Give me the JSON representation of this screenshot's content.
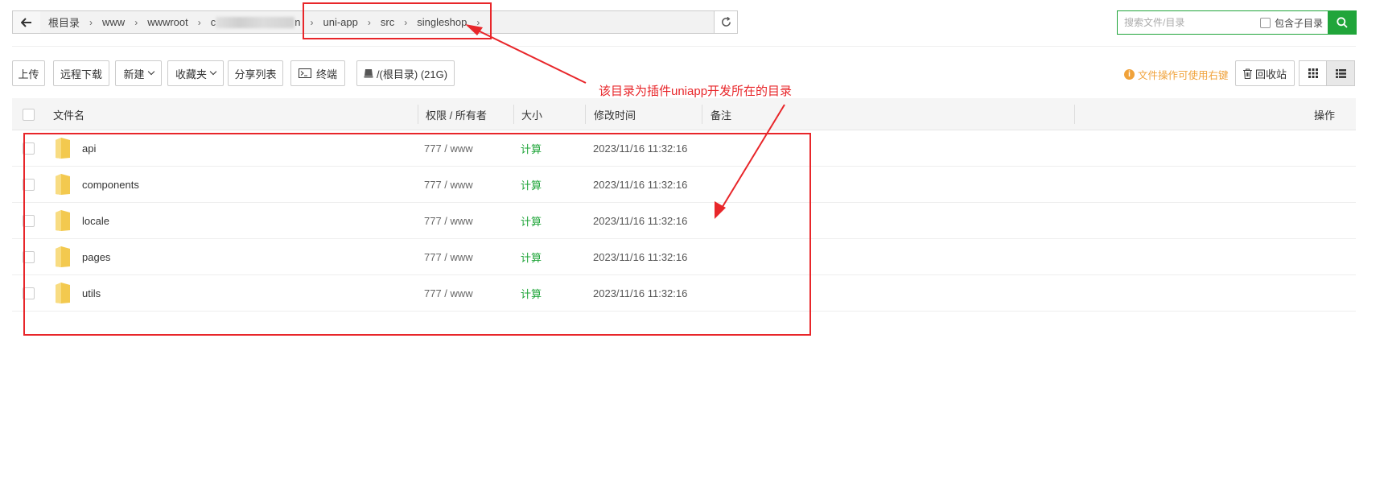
{
  "breadcrumb": {
    "items": [
      "根目录",
      "www",
      "wwwroot",
      "c",
      "n",
      "uni-app",
      "src",
      "singleshop"
    ]
  },
  "search": {
    "placeholder": "搜索文件/目录",
    "subdir_label": "包含子目录"
  },
  "toolbar": {
    "upload": "上传",
    "remote_download": "远程下载",
    "new": "新建",
    "favorites": "收藏夹",
    "share_list": "分享列表",
    "terminal": "终端",
    "disk": "/(根目录) (21G)",
    "tip": "文件操作可使用右键",
    "recycle_bin": "回收站"
  },
  "table": {
    "headers": {
      "name": "文件名",
      "perm": "权限 / 所有者",
      "size": "大小",
      "mtime": "修改时间",
      "note": "备注",
      "ops": "操作"
    },
    "rows": [
      {
        "name": "api",
        "perm": "777 / www",
        "size": "计算",
        "mtime": "2023/11/16 11:32:16"
      },
      {
        "name": "components",
        "perm": "777 / www",
        "size": "计算",
        "mtime": "2023/11/16 11:32:16"
      },
      {
        "name": "locale",
        "perm": "777 / www",
        "size": "计算",
        "mtime": "2023/11/16 11:32:16"
      },
      {
        "name": "pages",
        "perm": "777 / www",
        "size": "计算",
        "mtime": "2023/11/16 11:32:16"
      },
      {
        "name": "utils",
        "perm": "777 / www",
        "size": "计算",
        "mtime": "2023/11/16 11:32:16"
      }
    ]
  },
  "annotation": {
    "text": "该目录为插件uniapp开发所在的目录",
    "color": "#e8262a"
  },
  "colors": {
    "accent": "#20a53a",
    "tip": "#f0a23a",
    "folder": "#f7d26b"
  }
}
